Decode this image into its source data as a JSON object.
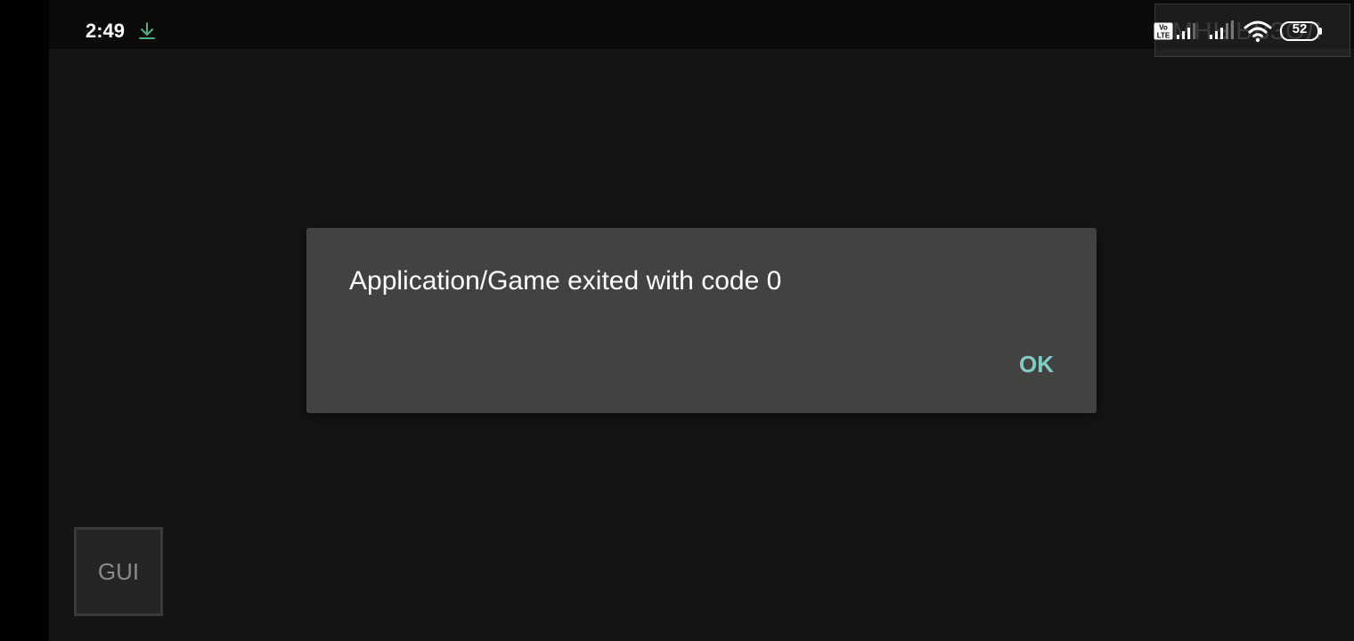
{
  "status_bar": {
    "time": "2:49",
    "icons": [
      "download-icon",
      "volte-icon",
      "signal-icon",
      "signal-icon",
      "wifi-icon",
      "battery-icon"
    ],
    "volte_label_top": "Vo",
    "volte_label_bottom": "LTE",
    "battery_level": "52",
    "overlay_text": "МНЫЬВЗОЛ"
  },
  "dialog": {
    "message": "Application/Game exited with code 0",
    "ok_label": "OK",
    "accent_color": "#80cbc4"
  },
  "overlay_controls": {
    "gui_label": "GUI"
  },
  "colors": {
    "app_background": "#151515",
    "dialog_background": "#424242"
  }
}
